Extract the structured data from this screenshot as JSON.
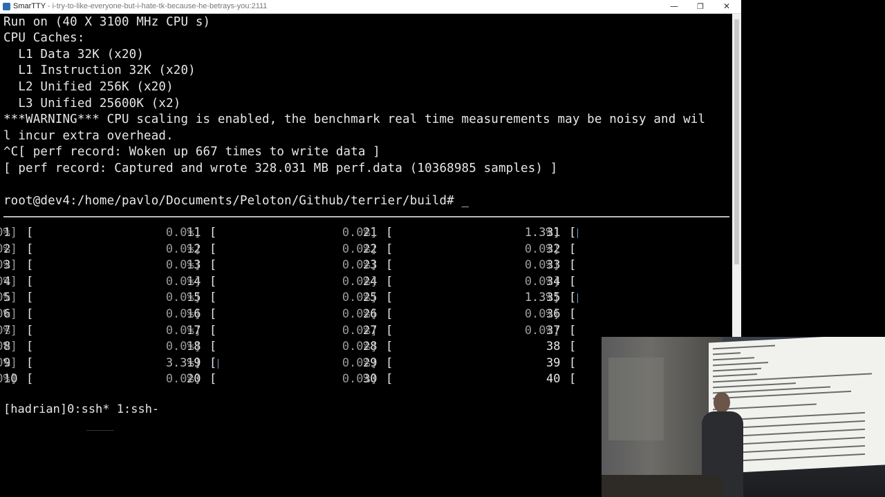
{
  "window": {
    "app_name": "SmarTTY",
    "title_suffix": " - i-try-to-like-everyone-but-i-hate-tk-because-he-betrays-you:2111",
    "btn_minimize": "—",
    "btn_restore": "❐",
    "btn_close": "✕"
  },
  "terminal": {
    "lines": [
      "Run on (40 X 3100 MHz CPU s)",
      "CPU Caches:",
      "  L1 Data 32K (x20)",
      "  L1 Instruction 32K (x20)",
      "  L2 Unified 256K (x20)",
      "  L3 Unified 25600K (x2)",
      "***WARNING*** CPU scaling is enabled, the benchmark real time measurements may be noisy and wil",
      "l incur extra overhead.",
      "^C[ perf record: Woken up 667 times to write data ]",
      "[ perf record: Captured and wrote 328.031 MB perf.data (10368985 samples) ]",
      "",
      "root@dev4:/home/pavlo/Documents/Peloton/Github/terrier/build# _"
    ],
    "prompt": "root@dev4:/home/pavlo/Documents/Peloton/Github/terrier/build#"
  },
  "htop": {
    "columns": [
      [
        {
          "n": "1",
          "p": "0.0%]"
        },
        {
          "n": "2",
          "p": "0.0%]"
        },
        {
          "n": "3",
          "p": "0.0%]"
        },
        {
          "n": "4",
          "p": "0.0%]"
        },
        {
          "n": "5",
          "p": "0.0%]"
        },
        {
          "n": "6",
          "p": "0.0%]"
        },
        {
          "n": "7",
          "p": "0.0%]"
        },
        {
          "n": "8",
          "p": "0.0%]"
        },
        {
          "n": "9",
          "p": "0.0%]"
        },
        {
          "n": "10",
          "p": "0.0%]"
        }
      ],
      [
        {
          "n": "11",
          "p": "0.0%]"
        },
        {
          "n": "12",
          "p": "0.0%]"
        },
        {
          "n": "13",
          "p": "0.0%]"
        },
        {
          "n": "14",
          "p": "0.0%]"
        },
        {
          "n": "15",
          "p": "0.0%]"
        },
        {
          "n": "16",
          "p": "0.0%]"
        },
        {
          "n": "17",
          "p": "0.0%]"
        },
        {
          "n": "18",
          "p": "0.0%]"
        },
        {
          "n": "19",
          "p": "3.3%]"
        },
        {
          "n": "20",
          "p": "0.0%]"
        }
      ],
      [
        {
          "n": "21",
          "p": "0.0%]"
        },
        {
          "n": "22",
          "p": "0.0%]"
        },
        {
          "n": "23",
          "p": "0.0%]"
        },
        {
          "n": "24",
          "p": "0.0%]"
        },
        {
          "n": "25",
          "p": "0.0%]"
        },
        {
          "n": "26",
          "p": "0.0%]"
        },
        {
          "n": "27",
          "p": "0.0%]"
        },
        {
          "n": "28",
          "p": "0.0%]"
        },
        {
          "n": "29",
          "p": "0.0%]"
        },
        {
          "n": "30",
          "p": "0.0%]"
        }
      ],
      [
        {
          "n": "31",
          "p": "1.3%]"
        },
        {
          "n": "32",
          "p": "0.0%]"
        },
        {
          "n": "33",
          "p": "0.0%]"
        },
        {
          "n": "34",
          "p": "0.0%]"
        },
        {
          "n": "35",
          "p": "1.3%]"
        },
        {
          "n": "36",
          "p": "0.0%]"
        },
        {
          "n": "37",
          "p": "0.0%]"
        },
        {
          "n": "38",
          "p": ""
        },
        {
          "n": "39",
          "p": ""
        },
        {
          "n": "40",
          "p": ""
        }
      ]
    ]
  },
  "tmux": {
    "status": "[hadrian]0:ssh* 1:ssh-"
  },
  "colors": {
    "terminal_bg": "#000000",
    "terminal_fg": "#e8e8e8",
    "percent_fg": "#9a9a9a",
    "titlebar_bg": "#ffffff"
  }
}
